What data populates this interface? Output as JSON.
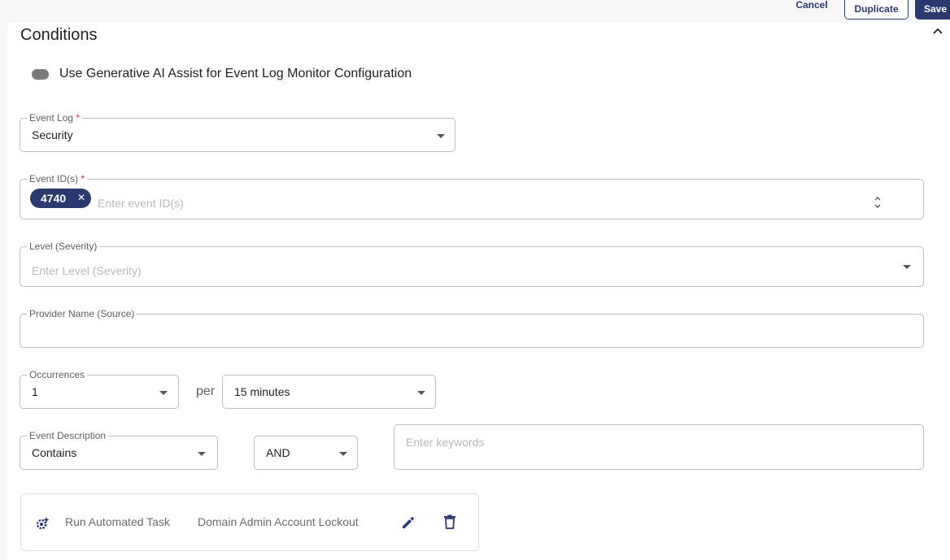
{
  "actions": {
    "cancel": "Cancel",
    "duplicate": "Duplicate",
    "save": "Save"
  },
  "section": {
    "title": "Conditions"
  },
  "ai_toggle": {
    "label": "Use Generative AI Assist for Event Log Monitor Configuration",
    "enabled": false
  },
  "event_log": {
    "label": "Event Log",
    "required": "*",
    "value": "Security"
  },
  "event_ids": {
    "label": "Event ID(s)",
    "required": "*",
    "chips": [
      "4740"
    ],
    "placeholder": "Enter event ID(s)"
  },
  "level": {
    "label": "Level (Severity)",
    "placeholder": "Enter Level (Severity)"
  },
  "provider": {
    "label": "Provider Name (Source)",
    "value": ""
  },
  "occurrences": {
    "label": "Occurrences",
    "value": "1",
    "per_label": "per",
    "interval": "15 minutes"
  },
  "event_description": {
    "label": "Event Description",
    "operator": "Contains",
    "logic": "AND",
    "keywords_placeholder": "Enter keywords"
  },
  "task": {
    "type": "Run Automated Task",
    "name": "Domain Admin Account Lockout"
  },
  "colors": {
    "primary": "#2b3a6e",
    "required": "#d32f2f",
    "border": "#bdbdbd"
  }
}
